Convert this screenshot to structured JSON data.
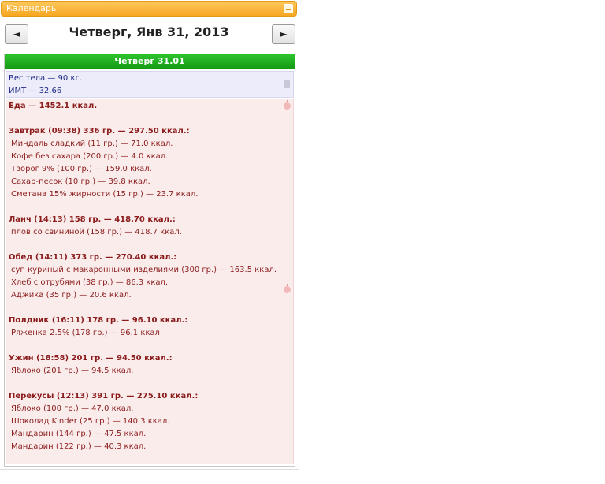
{
  "window": {
    "title": "Календарь"
  },
  "nav": {
    "prev": "◄",
    "next": "►",
    "date": "Четверг, Янв 31, 2013"
  },
  "day": {
    "header": "Четверг 31.01",
    "weight": "Вес тела — 90 кг.",
    "bmi": "ИМТ — 32.66",
    "food_total": "Еда — 1452.1 ккал.",
    "meals": [
      {
        "title": "Завтрак (09:38) 336 гр. — 297.50 ккал.:",
        "items": [
          "Миндаль сладкий (11 гр.) — 71.0 ккал.",
          "Кофе без сахара (200 гр.) — 4.0 ккал.",
          "Творог 9% (100 гр.) — 159.0 ккал.",
          "Сахар-песок (10 гр.) — 39.8 ккал.",
          "Сметана 15% жирности (15 гр.) — 23.7 ккал."
        ]
      },
      {
        "title": "Ланч (14:13) 158 гр. — 418.70 ккал.:",
        "items": [
          "плов со свининой (158 гр.) — 418.7 ккал."
        ]
      },
      {
        "title": "Обед (14:11) 373 гр. — 270.40 ккал.:",
        "items": [
          "суп куриный с макаронными изделиями (300 гр.) — 163.5 ккал.",
          "Хлеб с отрубями (38 гр.) — 86.3 ккал.",
          "Аджика (35 гр.) — 20.6 ккал."
        ]
      },
      {
        "title": "Полдник (16:11) 178 гр. — 96.10 ккал.:",
        "items": [
          "Ряженка 2.5% (178 гр.) — 96.1 ккал."
        ]
      },
      {
        "title": "Ужин (18:58) 201 гр. — 94.50 ккал.:",
        "items": [
          "Яблоко (201 гр.) — 94.5 ккал."
        ]
      },
      {
        "title": "Перекусы (12:13) 391 гр. — 275.10 ккал.:",
        "items": [
          "Яблоко (100 гр.) — 47.0 ккал.",
          "Шоколад Kinder (25 гр.) — 140.3 ккал.",
          "Мандарин (144 гр.) — 47.5 ккал.",
          "Мандарин (122 гр.) — 40.3 ккал."
        ]
      }
    ]
  },
  "icons": {
    "minimize": "minimize-icon",
    "edit": "edit-icon",
    "apple": "apple-icon"
  },
  "colors": {
    "titlebar": "#f7a721",
    "day_header": "#1fb01f",
    "weight_text": "#1f2b86",
    "food_text": "#8b1c1c",
    "food_bg": "#fbecec",
    "weight_bg": "#ececfa"
  }
}
